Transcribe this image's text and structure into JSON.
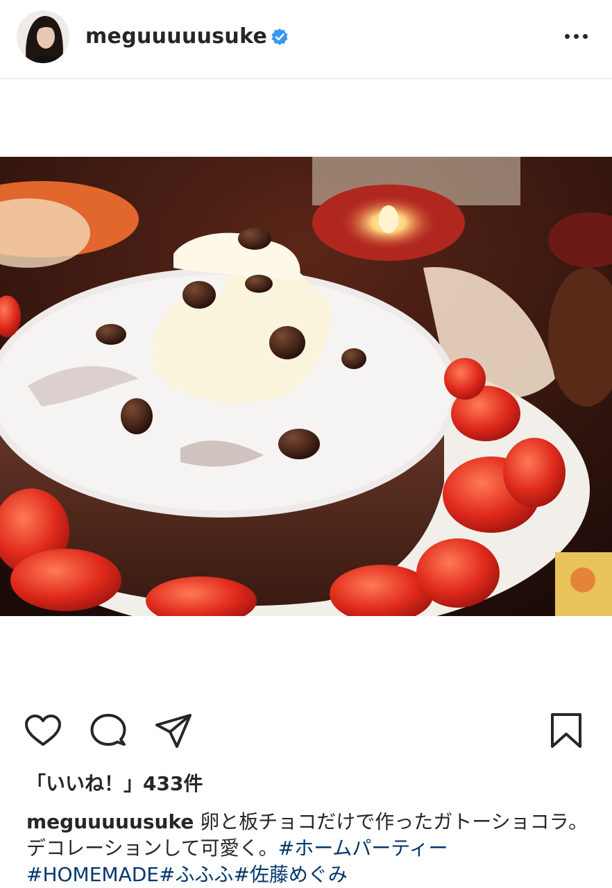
{
  "header": {
    "username": "meguuuuusuke",
    "verified": true,
    "more_icon": "more-horizontal-icon"
  },
  "post": {
    "image_description_icon": "cake-photo",
    "accent_color": "#3897f0"
  },
  "actions": {
    "like_icon": "heart-icon",
    "comment_icon": "comment-icon",
    "share_icon": "send-icon",
    "save_icon": "bookmark-icon"
  },
  "likes": {
    "text": "「いいね！」433件"
  },
  "caption": {
    "username": "meguuuuusuke",
    "text": " 卵と板チョコだけで作ったガトーショコラ。デコレーションして可愛く。",
    "hashtags": [
      "#ホームパーティー",
      "#HOMEMADE",
      "#ふふふ",
      "#佐藤めぐみ"
    ]
  }
}
